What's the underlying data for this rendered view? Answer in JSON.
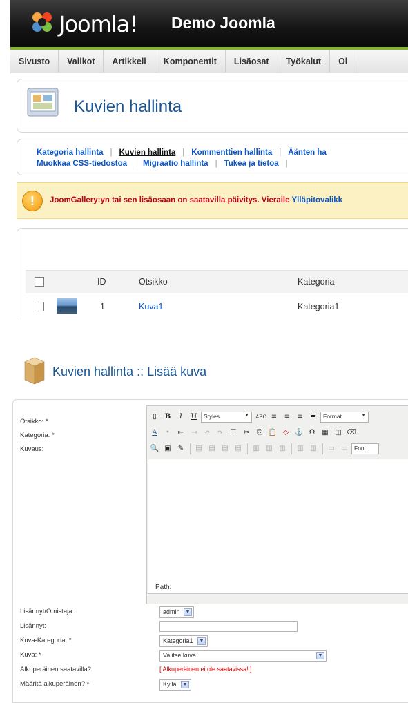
{
  "top": {
    "logo_text": "Joomla!",
    "site_name": "Demo Joomla",
    "menu": [
      "Sivusto",
      "Valikot",
      "Artikkeli",
      "Komponentit",
      "Lisäosat",
      "Työkalut",
      "Ol"
    ],
    "page_title": "Kuvien hallinta",
    "submenu_row1": [
      "Kategoria hallinta",
      "Kuvien hallinta",
      "Kommenttien hallinta",
      "Äänten ha"
    ],
    "submenu_row2": [
      "Muokkaa CSS-tiedostoa",
      "Migraatio hallinta",
      "Tukea ja tietoa"
    ],
    "notice_text": "JoomGallery:yn tai sen lisäosaan on saatavilla päivitys. Vieraile",
    "notice_link": "Ylläpitovalikk",
    "table": {
      "headers": {
        "id": "ID",
        "title": "Otsikko",
        "category": "Kategoria"
      },
      "rows": [
        {
          "id": "1",
          "title": "Kuva1",
          "category": "Kategoria1"
        }
      ]
    }
  },
  "bottom": {
    "title": "Kuvien hallinta :: Lisää kuva",
    "labels": {
      "title": "Otsikko: *",
      "category": "Kategoria: *",
      "description": "Kuvaus:",
      "owner": "Lisännyt/Omistaja:",
      "added_by": "Lisännyt:",
      "image_category": "Kuva-Kategoria: *",
      "image": "Kuva: *",
      "original_available": "Alkuperäinen saatavilla?",
      "set_original": "Määritä alkuperäinen? *"
    },
    "values": {
      "owner": "admin",
      "image_category": "Kategoria1",
      "image": "Valitse kuva",
      "original_warning": "[ Alkuperäinen ei ole saatavissa! ]",
      "set_original": "Kyllä"
    },
    "editor": {
      "styles": "Styles",
      "format": "Format",
      "font": "Font",
      "path": "Path:"
    }
  }
}
